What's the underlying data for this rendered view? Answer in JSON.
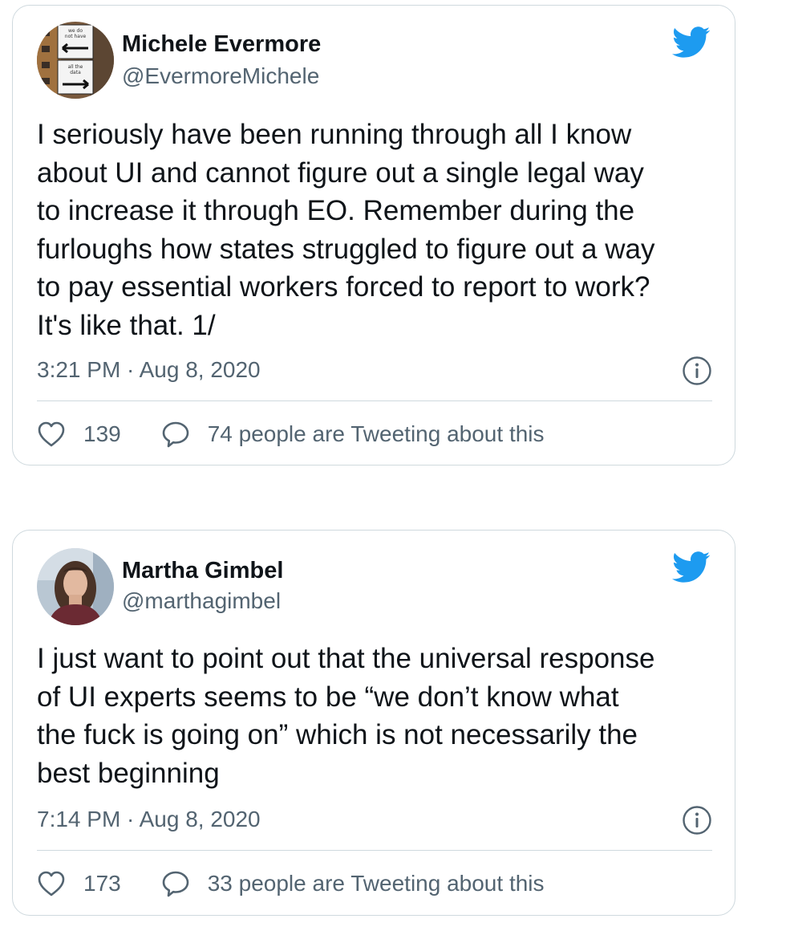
{
  "tweets": [
    {
      "author_name": "Michele Evermore",
      "author_handle": "@EvermoreMichele",
      "text": "I seriously have been running through all I know\nabout UI and cannot figure out a single legal way\nto increase it through EO. Remember during the\nfurloughs how states struggled to figure out a way\nto pay essential workers forced to report to work?\nIt's like that. 1/",
      "timestamp": "3:21 PM · Aug 8, 2020",
      "likes": "139",
      "tweeting_about": "74 people are Tweeting about this",
      "avatar_sign_text": [
        "we do",
        "not have",
        "all the",
        "data"
      ]
    },
    {
      "author_name": "Martha Gimbel",
      "author_handle": "@marthagimbel",
      "text": "I just want to point out that the universal response\nof UI experts seems to be “we don’t know what\nthe fuck is going on” which is not necessarily the\nbest beginning",
      "timestamp": "7:14 PM · Aug 8, 2020",
      "likes": "173",
      "tweeting_about": "33 people are Tweeting about this"
    }
  ],
  "icons": {
    "bird": "twitter-bird-icon",
    "info": "info-icon",
    "heart": "heart-icon",
    "reply": "reply-bubble-icon"
  },
  "colors": {
    "twitter_blue": "#1d9bf0",
    "text_primary": "#0f1419",
    "text_secondary": "#536471",
    "border": "#cfd9de"
  }
}
